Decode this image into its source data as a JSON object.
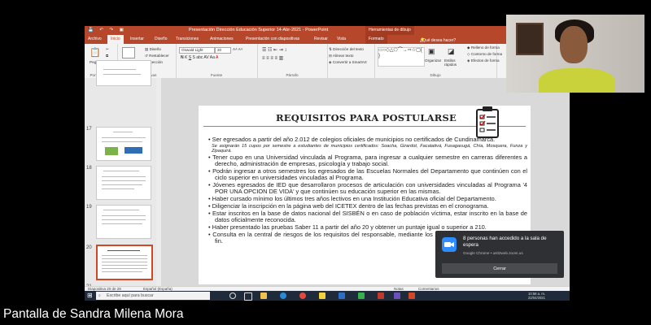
{
  "app": {
    "title": "Presentación Dirección Educación Superior 14-Abr-2021 - PowerPoint",
    "contextual_tab": "Herramientas de dibujo"
  },
  "ribbon_tabs": [
    "Archivo",
    "Inicio",
    "Insertar",
    "Diseño",
    "Transiciones",
    "Animaciones",
    "Presentación con diapositivas",
    "Revisar",
    "Vista",
    "Formato"
  ],
  "tell_me": "¿Qué desea hacer?",
  "ribbon": {
    "paste": "Pegar",
    "clipboard_group": "Portapapeles",
    "new_slide": "Nueva diapositiva",
    "layout": "Diseño",
    "reset": "Restablecer",
    "section": "Sección",
    "slides_group": "Diapositivas",
    "font_name": "Oswald Light",
    "font_size": "20",
    "font_group": "Fuente",
    "paragraph_group": "Párrafo",
    "text_direction": "Dirección del texto",
    "align_text": "Alinear texto",
    "smartart": "Convertir a SmartArt",
    "drawing_group": "Dibujo",
    "arrange": "Organizar",
    "quick_styles": "Estilos rápidos",
    "shape_fill": "Relleno de forma",
    "shape_outline": "Contorno de forma",
    "shape_effects": "Efectos de forma"
  },
  "thumbnails": [
    {
      "num": "17"
    },
    {
      "num": "18"
    },
    {
      "num": "19"
    },
    {
      "num": "20"
    },
    {
      "num": "21"
    }
  ],
  "slide": {
    "title": "REQUISITOS PARA POSTULARSE",
    "bullets": [
      {
        "text": "Ser egresados a partir del año 2.012 de colegios oficiales de municipios no certificados de Cundinamarca.",
        "note": "Se asignarán 15 cupos por semestre a estudiantes de municipios certificados: Soacha, Girardot, Facatativá, Fusagasugá, Chía, Mosquera, Funza y  Zipaquirá."
      },
      {
        "text": "Tener cupo en una Universidad vinculada al Programa, para ingresar a cualquier semestre en carreras diferentes a derecho, administración de empresas, psicología y trabajo social."
      },
      {
        "text": "Podrán ingresar a otros semestres los egresados de las Escuelas Normales del Departamento que continúen con el ciclo superior en universidades vinculadas al Programa."
      },
      {
        "text": "Jóvenes egresados de IED que desarrollaron procesos de articulación con universidades vinculadas al Programa '4 POR UNA OPCION DE VIDA' y que continúen su educación superior en las mismas."
      },
      {
        "text": "Haber cursado mínimo los últimos tres años lectivos en una Institución Educativa oficial del Departamento."
      },
      {
        "text": "Diligenciar la inscripción en la página web del ICETEX dentro de las fechas previstas en el cronograma."
      },
      {
        "text": "Estar inscritos en la base de datos nacional del SISBÉN o en caso de población víctima, estar inscrito en la base de datos oficialmente reconocida."
      },
      {
        "text": "Haber presentado las pruebas Saber 11 a partir del año 20     y obtener un puntaje igual o superior a 210."
      },
      {
        "text": "Consulta en la central de riesgos de los requisitos del responsable,     mediante los meganismos establecidos para tal fin."
      }
    ]
  },
  "status": {
    "slide_counter": "Diapositiva 20 de 28",
    "language": "Español (España)",
    "notes": "Notas",
    "comments": "Comentarios"
  },
  "taskbar": {
    "search_placeholder": "Escribe aquí para buscar",
    "time": "10:58 a. m.",
    "date": "22/04/2021"
  },
  "notification": {
    "title": "8 personas han accedido a la sala de espera",
    "source": "Google Chrome • us02web.zoom.us",
    "close_label": "Cerrar"
  },
  "caption": "Pantalla de Sandra Milena Mora",
  "colors": {
    "powerpoint": "#b7472a",
    "zoom": "#2d8cff"
  }
}
